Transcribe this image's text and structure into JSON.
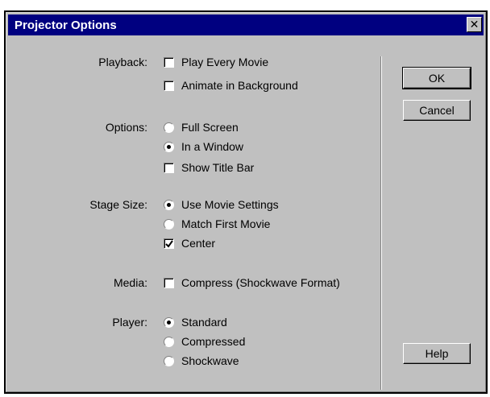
{
  "title": "Projector Options",
  "close_glyph": "✕",
  "playback": {
    "label": "Playback:",
    "items": [
      {
        "text": "Play Every Movie",
        "checked": false
      },
      {
        "text": "Animate in Background",
        "checked": false
      }
    ]
  },
  "options": {
    "label": "Options:",
    "items": [
      {
        "text": "Full Screen",
        "selected": false
      },
      {
        "text": "In a Window",
        "selected": true
      },
      {
        "text": "Show Title Bar",
        "checked": false
      }
    ]
  },
  "stage_size": {
    "label": "Stage Size:",
    "items": [
      {
        "text": "Use Movie Settings",
        "selected": true
      },
      {
        "text": "Match First Movie",
        "selected": false
      },
      {
        "text": "Center",
        "checked": true
      }
    ]
  },
  "media": {
    "label": "Media:",
    "items": [
      {
        "text": "Compress (Shockwave Format)",
        "checked": false
      }
    ]
  },
  "player": {
    "label": "Player:",
    "items": [
      {
        "text": "Standard",
        "selected": true
      },
      {
        "text": "Compressed",
        "selected": false
      },
      {
        "text": "Shockwave",
        "selected": false
      }
    ]
  },
  "buttons": {
    "ok": "OK",
    "cancel": "Cancel",
    "help": "Help"
  }
}
